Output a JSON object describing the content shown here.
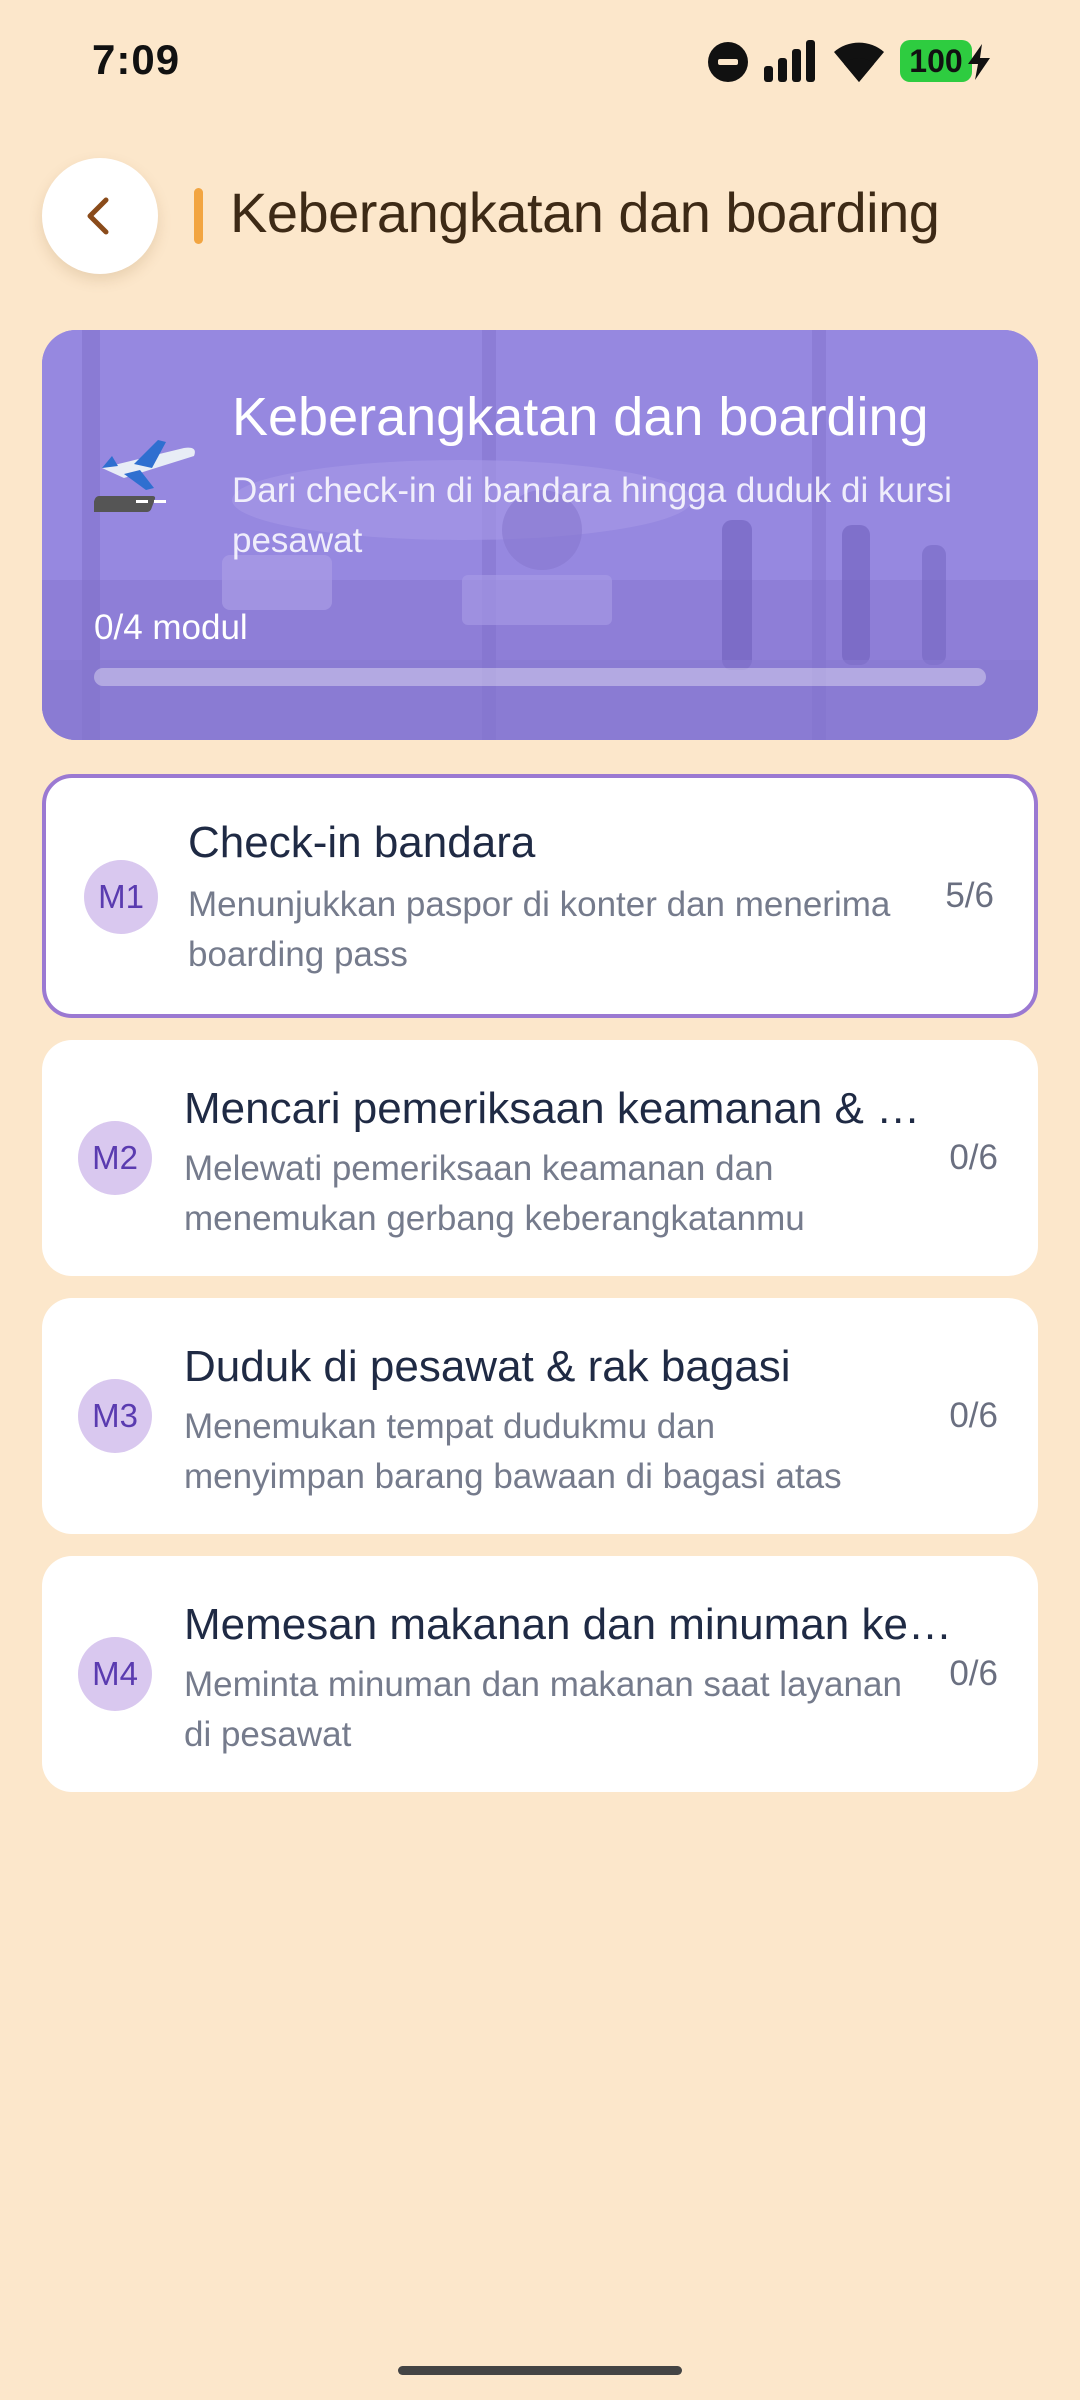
{
  "status_bar": {
    "time": "7:09",
    "battery": "100",
    "icons": [
      "do-not-disturb-icon",
      "signal-icon",
      "wifi-icon",
      "battery-icon",
      "charging-bolt-icon"
    ]
  },
  "header": {
    "back_icon": "chevron-left-icon",
    "title": "Keberangkatan dan boarding",
    "accent_color": "#f2a541"
  },
  "hero": {
    "icon": "airplane-icon",
    "title": "Keberangkatan dan boarding",
    "subtitle": "Dari check-in di bandara hingga duduk di kursi pesawat",
    "progress_label": "0/4 modul",
    "progress_fraction": 0.0,
    "background_color": "#8f80de"
  },
  "modules": [
    {
      "badge": "M1",
      "title": "Check-in bandara",
      "description": "Menunjukkan paspor di konter dan menerima boarding pass",
      "progress": "5/6",
      "active": true
    },
    {
      "badge": "M2",
      "title": "Mencari pemeriksaan keamanan & g…",
      "description": "Melewati pemeriksaan keamanan dan menemukan gerbang keberangkatanmu",
      "progress": "0/6",
      "active": false
    },
    {
      "badge": "M3",
      "title": "Duduk di pesawat & rak bagasi",
      "description": "Menemukan tempat dudukmu dan menyimpan barang bawaan di bagasi atas",
      "progress": "0/6",
      "active": false
    },
    {
      "badge": "M4",
      "title": "Memesan makanan dan minuman ke…",
      "description": "Meminta minuman dan makanan saat layanan di pesawat",
      "progress": "0/6",
      "active": false
    }
  ],
  "colors": {
    "background": "#fce7cb",
    "active_border": "#9b79d2",
    "badge_bg": "#d9c8ef",
    "badge_text": "#5a3bb0"
  }
}
